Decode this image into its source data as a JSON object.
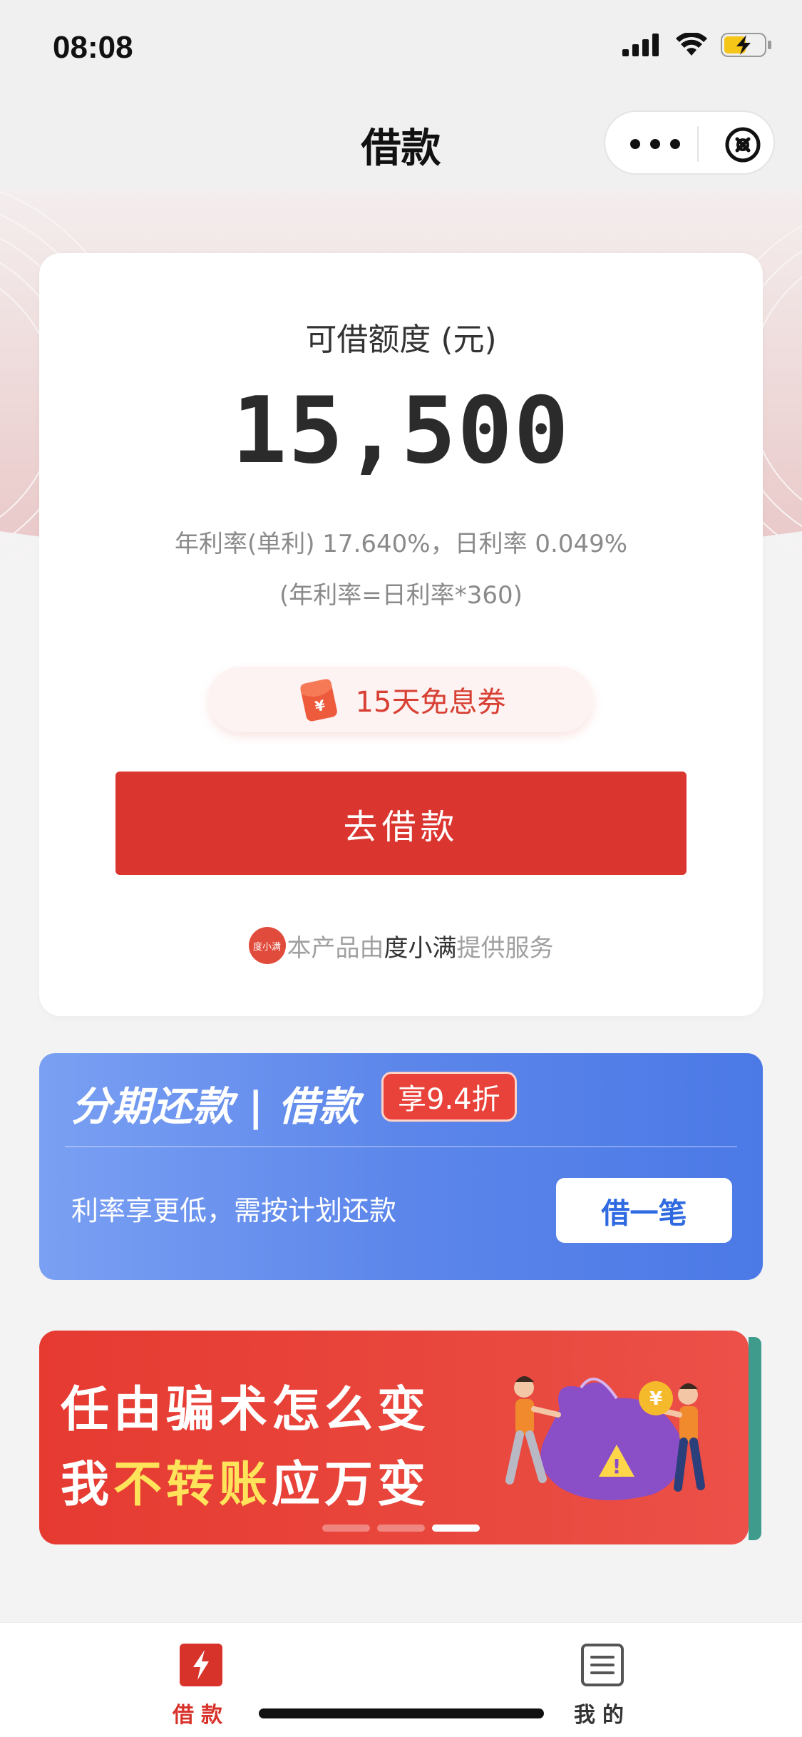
{
  "status_bar": {
    "time": "08:08"
  },
  "nav": {
    "title": "借款"
  },
  "credit": {
    "label": "可借额度 (元)",
    "amount": "15,500",
    "rate_line": "年利率(单利) 17.640%，日利率 0.049%",
    "rate_formula": "(年利率=日利率*360)",
    "coupon": "15天免息券",
    "borrow_button": "去借款",
    "provider_prefix": "本产品由",
    "provider_name": "度小满",
    "provider_suffix": "提供服务",
    "provider_logo_text": "度小满"
  },
  "installment": {
    "title": "分期还款 | 借款",
    "badge": "享9.4折",
    "description": "利率享更低，需按计划还款",
    "button": "借一笔"
  },
  "banner": {
    "line1": "任由骗术怎么变",
    "line2_prefix": "我",
    "line2_highlight": "不转账",
    "line2_suffix": "应万变",
    "active_slide": 3,
    "slide_count": 3
  },
  "tabs": [
    {
      "label": "借款",
      "icon": "lightning-icon",
      "active": true
    },
    {
      "label": "我的",
      "icon": "list-icon",
      "active": false
    }
  ],
  "colors": {
    "primary_red": "#da352f",
    "installment_blue": "#5c86ea",
    "highlight_yellow": "#ffe35a"
  }
}
